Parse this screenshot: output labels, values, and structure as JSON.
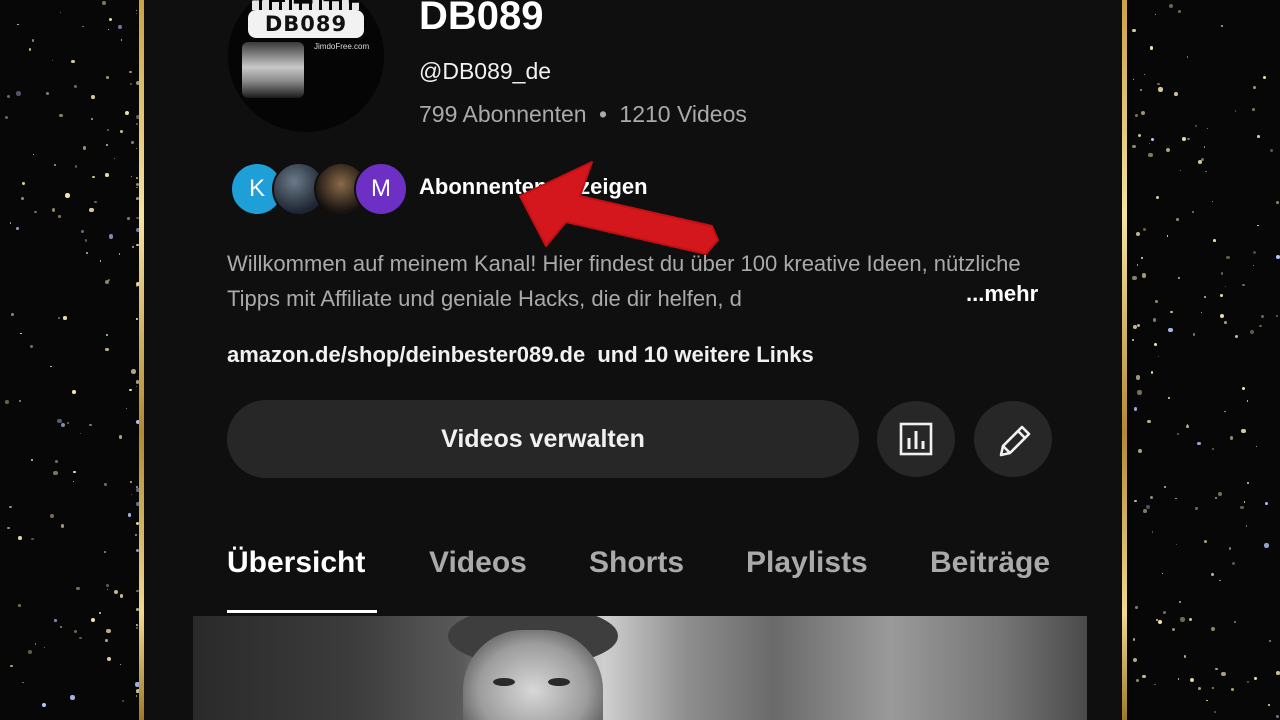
{
  "channel": {
    "name": "DB089",
    "handle": "@DB089_de",
    "subscribers": "799 Abonnenten",
    "separator": "•",
    "videos": "1210 Videos",
    "avatar_logo_text": "DB089",
    "avatar_sub_text": "JimdoFree.com"
  },
  "subscribers_preview": {
    "avatars": [
      "K",
      "",
      "",
      "M"
    ],
    "link_label": "Abonnenten anzeigen"
  },
  "description": {
    "text": "Willkommen auf meinem Kanal! Hier findest du über 100 kreative Ideen, nützliche Tipps mit Affiliate und geniale Hacks, die dir helfen, d",
    "more_label": "...mehr"
  },
  "links": {
    "primary": "amazon.de/shop/deinbester089.de",
    "more": "und 10 weitere Links"
  },
  "actions": {
    "manage_videos": "Videos verwalten",
    "analytics_icon": "bar-chart-icon",
    "edit_icon": "pencil-icon"
  },
  "tabs": [
    {
      "label": "Übersicht",
      "active": true
    },
    {
      "label": "Videos",
      "active": false
    },
    {
      "label": "Shorts",
      "active": false
    },
    {
      "label": "Playlists",
      "active": false
    },
    {
      "label": "Beiträge",
      "active": false
    }
  ],
  "colors": {
    "background": "#0f0f0f",
    "button": "#272727",
    "secondary_text": "#aaaaaa",
    "annotation_arrow": "#d3171c",
    "frame_gold": "#d9b862"
  }
}
